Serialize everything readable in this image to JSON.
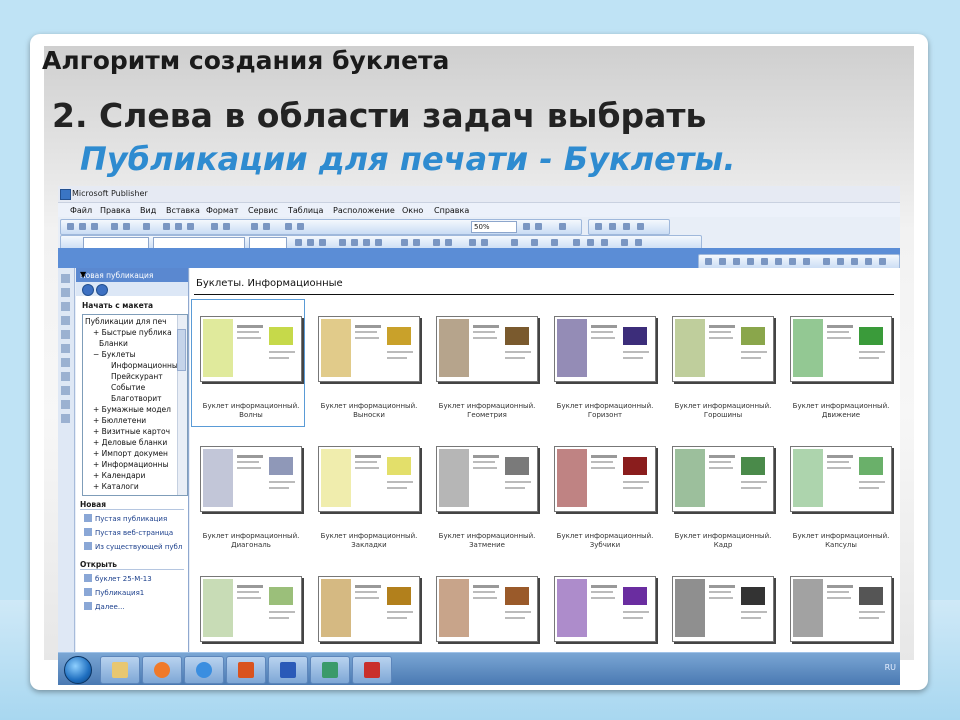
{
  "slide": {
    "title": "Алгоритм создания буклета",
    "step_line1": "2. Слева в области задач выбрать",
    "step_line2": "Публикации для печати - Буклеты."
  },
  "publisher": {
    "window_title": "Microsoft Publisher",
    "menu": [
      "Файл",
      "Правка",
      "Вид",
      "Вставка",
      "Формат",
      "Сервис",
      "Таблица",
      "Расположение",
      "Окно",
      "Справка"
    ],
    "zoom_value": "50%",
    "task_pane": {
      "title": "Новая публикация",
      "start_label": "Начать с макета",
      "tree_items": [
        "Публикации для печ",
        "Быстрые публика",
        "Бланки",
        "Буклеты",
        "Информационные",
        "Прейскурант",
        "Событие",
        "Благотворит",
        "Бумажные модел",
        "Бюллетени",
        "Визитные карточ",
        "Деловые бланки",
        "Импорт докумен",
        "Информационны",
        "Календари",
        "Каталоги"
      ],
      "new_section": "Новая",
      "new_links": [
        "Пустая публикация",
        "Пустая веб-страница",
        "Из существующей публ"
      ],
      "open_section": "Открыть",
      "open_links": [
        "буклет 25-М-13",
        "Публикация1",
        "Далее..."
      ]
    },
    "gallery": {
      "heading": "Буклеты. Информационные",
      "items": [
        {
          "line1": "Буклет информационный.",
          "line2": "Волны",
          "accent": "#c6d94a"
        },
        {
          "line1": "Буклет информационный.",
          "line2": "Выноски",
          "accent": "#c9a12a"
        },
        {
          "line1": "Буклет информационный.",
          "line2": "Геометрия",
          "accent": "#7a5a2e"
        },
        {
          "line1": "Буклет информационный.",
          "line2": "Горизонт",
          "accent": "#3c2d7a"
        },
        {
          "line1": "Буклет информационный.",
          "line2": "Горошины",
          "accent": "#8aa64b"
        },
        {
          "line1": "Буклет информационный.",
          "line2": "Движение",
          "accent": "#3a9b3a"
        },
        {
          "line1": "Буклет информационный.",
          "line2": "Диагональ",
          "accent": "#8f98b8"
        },
        {
          "line1": "Буклет информационный.",
          "line2": "Закладки",
          "accent": "#e3df6a"
        },
        {
          "line1": "Буклет информационный.",
          "line2": "Затмение",
          "accent": "#7a7a7a"
        },
        {
          "line1": "Буклет информационный.",
          "line2": "Зубчики",
          "accent": "#8a1d1d"
        },
        {
          "line1": "Буклет информационный.",
          "line2": "Кадр",
          "accent": "#4a8a4a"
        },
        {
          "line1": "Буклет информационный.",
          "line2": "Капсулы",
          "accent": "#6ab06a"
        },
        {
          "line1": "",
          "line2": "",
          "accent": "#9bbf7a"
        },
        {
          "line1": "",
          "line2": "",
          "accent": "#b2801c"
        },
        {
          "line1": "",
          "line2": "",
          "accent": "#9a5a2a"
        },
        {
          "line1": "",
          "line2": "",
          "accent": "#6a2da0"
        },
        {
          "line1": "",
          "line2": "",
          "accent": "#333333"
        },
        {
          "line1": "",
          "line2": "",
          "accent": "#555555"
        }
      ]
    },
    "taskbar": {
      "lang": "RU"
    }
  }
}
